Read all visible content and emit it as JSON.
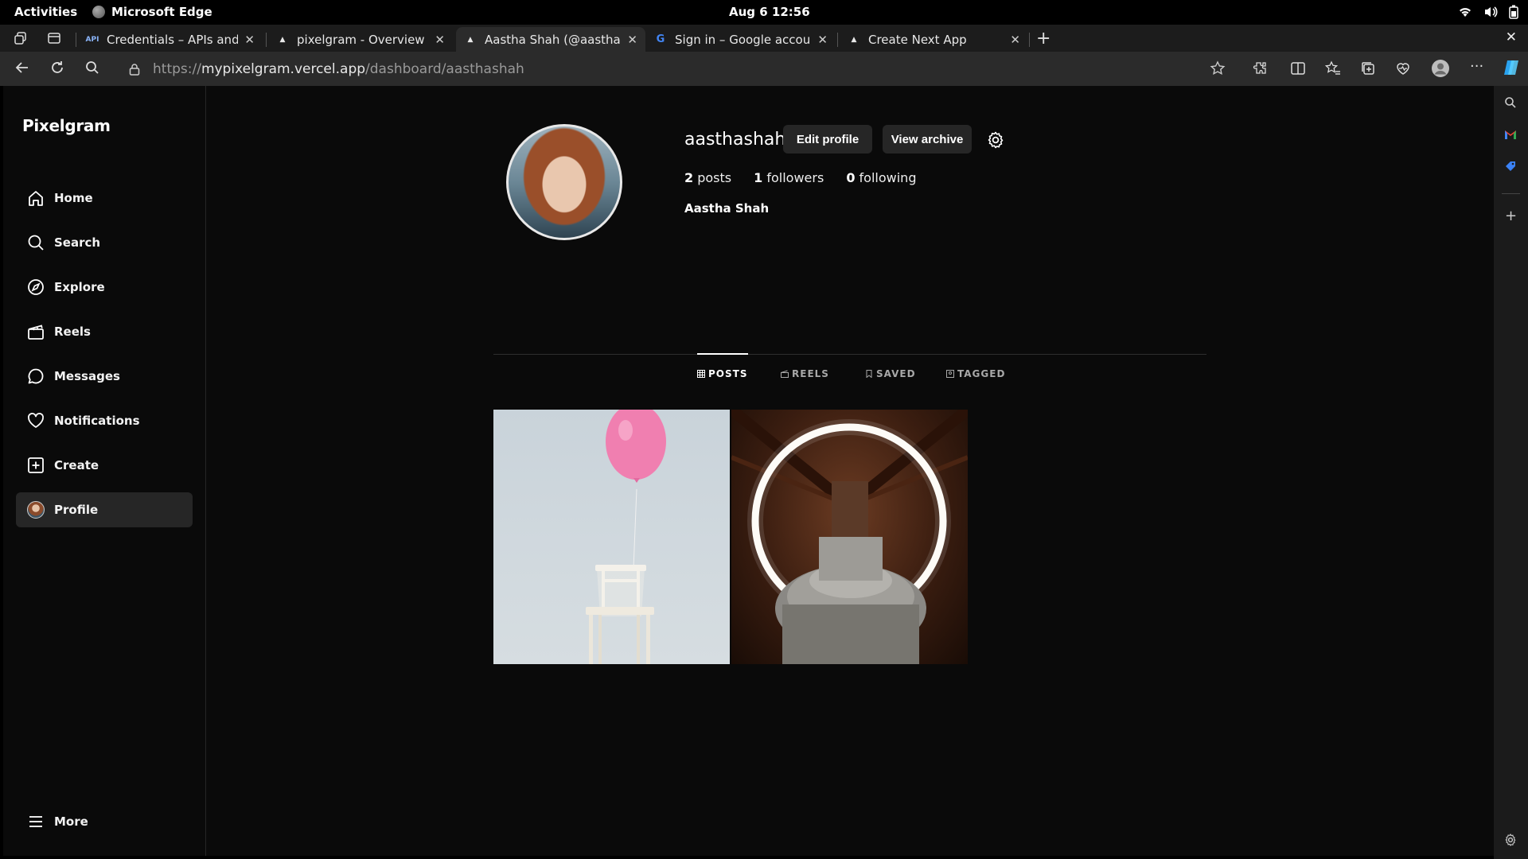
{
  "os": {
    "activities": "Activities",
    "app_name": "Microsoft Edge",
    "clock": "Aug 6  12:56"
  },
  "browser": {
    "tabs": [
      {
        "title": "Credentials – APIs and ser",
        "favicon": "API"
      },
      {
        "title": "pixelgram - Overview – Ve",
        "favicon": "vercel-triangle"
      },
      {
        "title": "Aastha Shah (@aasthasha",
        "favicon": "vercel-triangle",
        "active": true
      },
      {
        "title": "Sign in – Google accounts",
        "favicon": "google-g"
      },
      {
        "title": "Create Next App",
        "favicon": "vercel-triangle"
      }
    ],
    "url_scheme": "https://",
    "url_host": "mypixelgram.vercel.app",
    "url_path": "/dashboard/aasthashah"
  },
  "app": {
    "logo": "Pixelgram",
    "nav": [
      {
        "label": "Home",
        "icon": "home-icon"
      },
      {
        "label": "Search",
        "icon": "search-icon"
      },
      {
        "label": "Explore",
        "icon": "compass-icon"
      },
      {
        "label": "Reels",
        "icon": "clapperboard-icon"
      },
      {
        "label": "Messages",
        "icon": "chat-bubble-icon"
      },
      {
        "label": "Notifications",
        "icon": "heart-icon"
      },
      {
        "label": "Create",
        "icon": "plus-square-icon"
      },
      {
        "label": "Profile",
        "icon": "avatar",
        "active": true
      }
    ],
    "more_label": "More"
  },
  "profile": {
    "username": "aasthashah",
    "edit_label": "Edit profile",
    "archive_label": "View archive",
    "posts_count": "2",
    "posts_label": "posts",
    "followers_count": "1",
    "followers_label": "followers",
    "following_count": "0",
    "following_label": "following",
    "full_name": "Aastha Shah",
    "tabs": [
      {
        "label": "POSTS",
        "active": true
      },
      {
        "label": "REELS"
      },
      {
        "label": "SAVED"
      },
      {
        "label": "TAGGED"
      }
    ],
    "posts": [
      {
        "subject": "pink balloon tied to white chair"
      },
      {
        "subject": "glowing ring light over stone pillar"
      }
    ]
  },
  "colors": {
    "background": "#0a0a0a",
    "active_nav": "#262626",
    "button": "#262626",
    "text": "#ffffff"
  }
}
